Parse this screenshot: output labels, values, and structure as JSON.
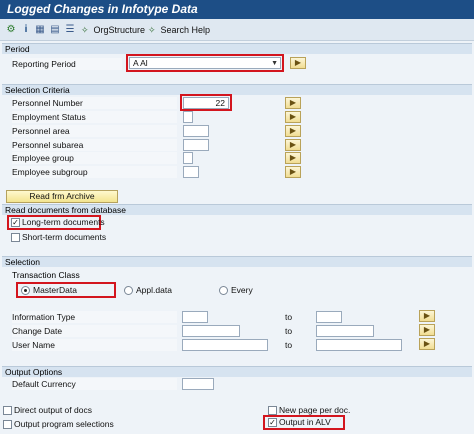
{
  "title": "Logged Changes in Infotype Data",
  "toolbar": {
    "org_structure": "OrgStructure",
    "search_help": "Search Help"
  },
  "period": {
    "header": "Period",
    "reporting_period_label": "Reporting Period",
    "reporting_period_value": "A Al"
  },
  "selection_criteria": {
    "header": "Selection Criteria",
    "rows": [
      {
        "label": "Personnel Number",
        "value": "22"
      },
      {
        "label": "Employment Status",
        "value": ""
      },
      {
        "label": "Personnel area",
        "value": ""
      },
      {
        "label": "Personnel subarea",
        "value": ""
      },
      {
        "label": "Employee group",
        "value": ""
      },
      {
        "label": "Employee subgroup",
        "value": ""
      }
    ],
    "read_archive_button": "Read frm Archive"
  },
  "read_documents": {
    "header": "Read documents from database",
    "long_term": "Long-term documents",
    "short_term": "Short-term documents",
    "long_term_checked": true,
    "short_term_checked": false
  },
  "selection": {
    "header": "Selection",
    "transaction_class": "Transaction Class",
    "master_data": "MasterData",
    "appl_data": "Appl.data",
    "every": "Every",
    "selected": "MasterData",
    "rows": [
      {
        "label": "Information Type",
        "to": "to"
      },
      {
        "label": "Change Date",
        "to": "to"
      },
      {
        "label": "User Name",
        "to": "to"
      }
    ]
  },
  "output_options": {
    "header": "Output Options",
    "default_currency": "Default Currency",
    "direct_output": "Direct output of docs",
    "output_program_selections": "Output program selections",
    "new_page": "New page per doc.",
    "output_alv": "Output in ALV",
    "output_alv_checked": true
  },
  "colors": {
    "title_bar": "#1d4e86",
    "highlight": "#d3151e",
    "section_header": "#d6e3f0"
  }
}
